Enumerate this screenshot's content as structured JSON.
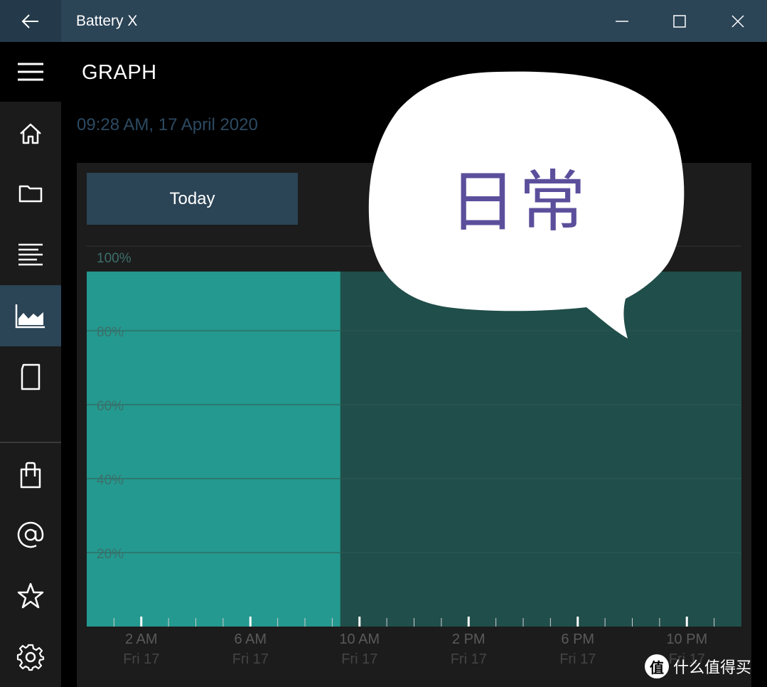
{
  "window": {
    "title": "Battery X",
    "back_icon": "arrow-left-icon",
    "controls": [
      "minimize-icon",
      "maximize-icon",
      "close-icon"
    ]
  },
  "sidebar": {
    "menu_icon": "hamburger-icon",
    "items": [
      {
        "icon": "home-icon",
        "active": false
      },
      {
        "icon": "folder-icon",
        "active": false
      },
      {
        "icon": "text-lines-icon",
        "active": false
      },
      {
        "icon": "area-chart-icon",
        "active": true
      },
      {
        "icon": "page-icon",
        "active": false
      },
      {
        "icon": "shopping-bag-icon",
        "active": false
      },
      {
        "icon": "at-sign-icon",
        "active": false
      },
      {
        "icon": "star-icon",
        "active": false
      },
      {
        "icon": "gear-icon",
        "active": false
      }
    ]
  },
  "main": {
    "title": "GRAPH",
    "timestamp": "09:28 AM, 17 April 2020",
    "today_button": "Today"
  },
  "chart_data": {
    "type": "area",
    "y_ticks": [
      "100%",
      "80%",
      "60%",
      "40%",
      "20%"
    ],
    "ylim": [
      0,
      100
    ],
    "x_ticks": [
      {
        "time": "2 AM",
        "day": "Fri 17"
      },
      {
        "time": "6 AM",
        "day": "Fri 17"
      },
      {
        "time": "10 AM",
        "day": "Fri 17"
      },
      {
        "time": "2 PM",
        "day": "Fri 17"
      },
      {
        "time": "6 PM",
        "day": "Fri 17"
      },
      {
        "time": "10 PM",
        "day": "Fri 17"
      }
    ],
    "x_range_hours": [
      0,
      24
    ],
    "segments": [
      {
        "start_hour": 0,
        "end_hour": 9.3,
        "battery_percent": 96,
        "kind": "measured"
      },
      {
        "start_hour": 9.3,
        "end_hour": 24,
        "battery_percent": 96,
        "kind": "projected"
      }
    ],
    "colors": {
      "measured": "#24998f",
      "projected": "#204e4a",
      "grid": "#2f5a56",
      "tick_label": "#3d6f6a",
      "axis_label": "#5a5a5a"
    }
  },
  "overlay": {
    "bubble_text": "日常"
  },
  "watermark": {
    "logo": "值",
    "text": "什么值得买"
  }
}
